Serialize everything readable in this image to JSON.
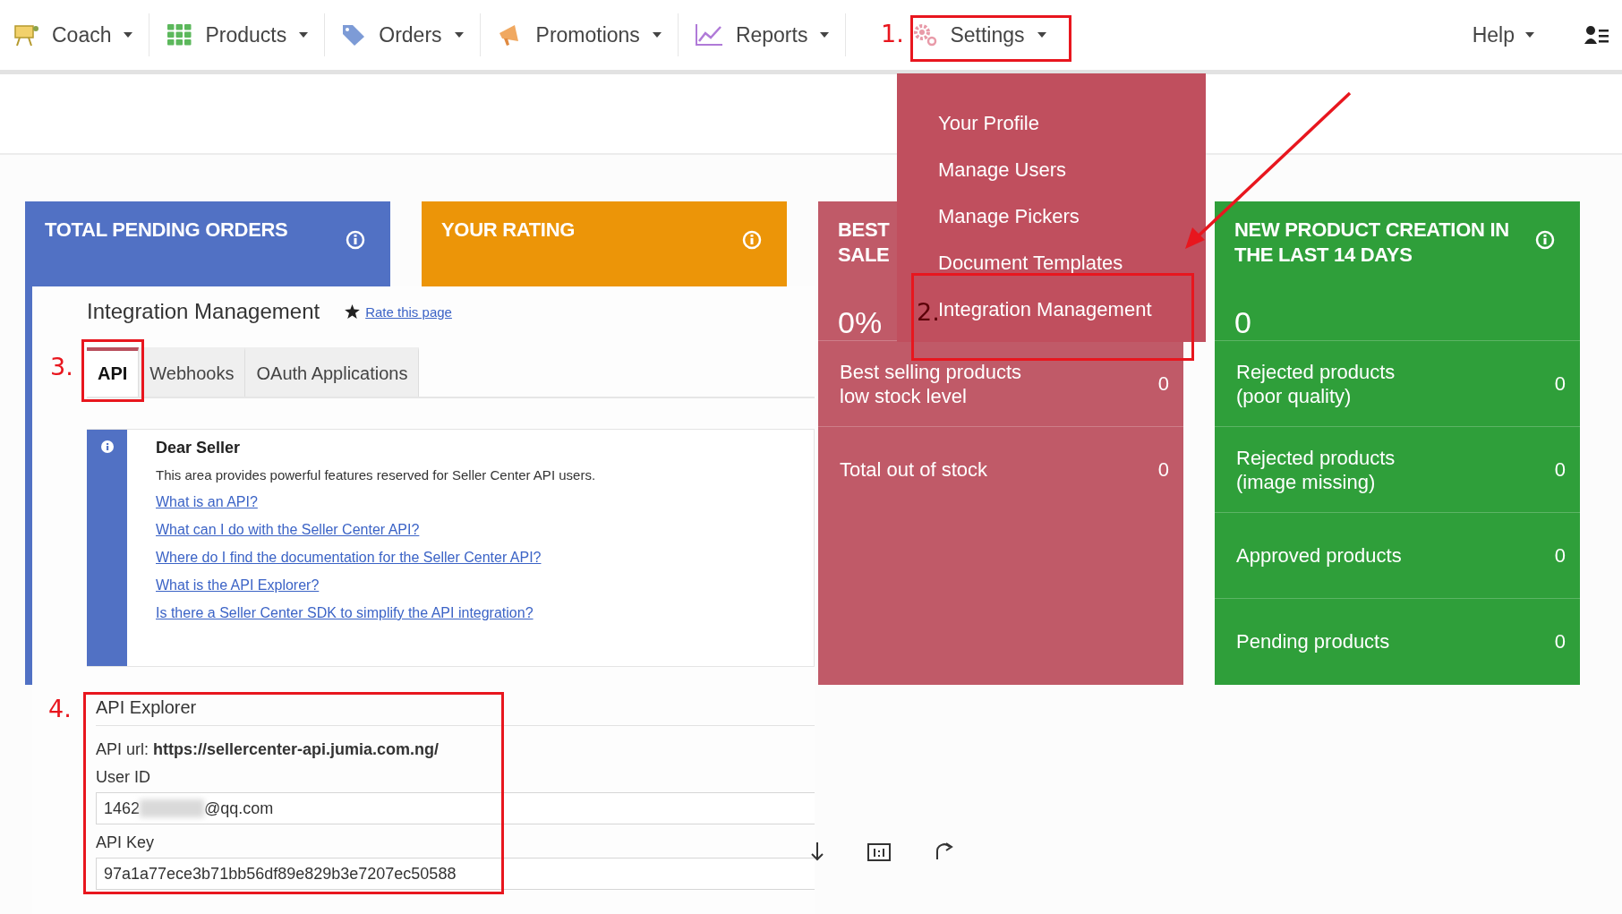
{
  "nav": {
    "items": [
      {
        "label": "Coach"
      },
      {
        "label": "Products"
      },
      {
        "label": "Orders"
      },
      {
        "label": "Promotions"
      },
      {
        "label": "Reports"
      },
      {
        "label": "Settings",
        "menu": [
          "Your Profile",
          "Manage Users",
          "Manage Pickers",
          "Document Templates",
          "Integration Management"
        ]
      }
    ],
    "help": {
      "label": "Help"
    }
  },
  "cards": [
    {
      "title": "TOTAL PENDING ORDERS",
      "color": "#5171c4",
      "info_icon": true,
      "tall": true
    },
    {
      "title": "YOUR RATING",
      "color": "#ec9508",
      "info_icon": true,
      "tall": false
    },
    {
      "title": "BEST\nSALE",
      "value": "0%",
      "color": "#c05a68",
      "info_icon": false,
      "tall": true,
      "rows": [
        {
          "label": "Best selling products\nlow stock level",
          "value": "0"
        },
        {
          "label": "Total out of stock",
          "value": "0"
        }
      ]
    },
    {
      "title": "NEW PRODUCT CREATION IN THE LAST 14 DAYS",
      "value": "0",
      "color": "#2f9f3a",
      "info_icon": true,
      "tall": true,
      "rows": [
        {
          "label": "Rejected products\n(poor quality)",
          "value": "0"
        },
        {
          "label": "Rejected products\n(image missing)",
          "value": "0"
        },
        {
          "label": "Approved products",
          "value": "0"
        },
        {
          "label": "Pending products",
          "value": "0"
        }
      ]
    }
  ],
  "panel": {
    "title": "Integration Management",
    "rate_link": "Rate this page",
    "tabs": [
      {
        "label": "API",
        "selected": true
      },
      {
        "label": "Webhooks",
        "selected": false
      },
      {
        "label": "OAuth Applications",
        "selected": false
      }
    ],
    "notice": {
      "heading": "Dear Seller",
      "text": "This area provides powerful features reserved for Seller Center API users.",
      "links": [
        "What is an API?",
        "What can I do with the Seller Center API?",
        "Where do I find the documentation for the Seller Center API?",
        "What is the API Explorer?",
        "Is there a Seller Center SDK to simplify the API integration?"
      ]
    },
    "explorer": {
      "heading": "API Explorer",
      "url_line": "API url: **https://sellercenter-api.jumia.com.ng/**",
      "user_id": {
        "label": "User ID",
        "value_start": "1462",
        "value_end": "@qq.com"
      },
      "api_key": {
        "label": "API Key",
        "value": "97a1a77ece3b71bb56df89e829b3e7207ec50588"
      }
    }
  },
  "annotations": [
    "1.",
    "2.",
    "3.",
    "4."
  ]
}
